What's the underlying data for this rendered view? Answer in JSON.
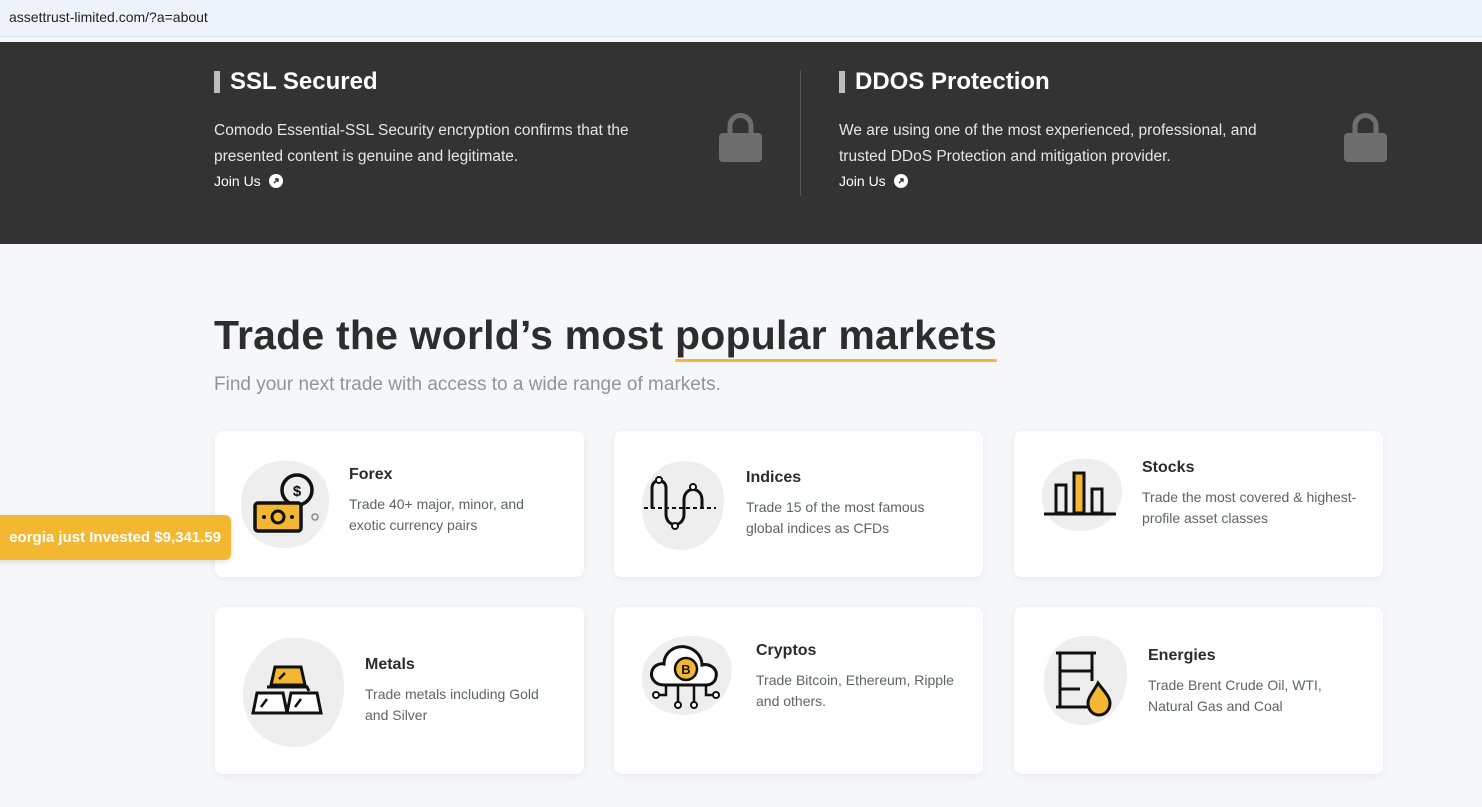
{
  "browser": {
    "url": "assettrust-limited.com/?a=about"
  },
  "security": {
    "ssl": {
      "title": "SSL Secured",
      "description": "Comodo Essential-SSL Security encryption confirms that the presented content is genuine and legitimate.",
      "link": "Join Us"
    },
    "ddos": {
      "title": "DDOS Protection",
      "description": "We are using one of the most experienced, professional, and trusted DDoS Protection and mitigation provider.",
      "link": "Join Us"
    }
  },
  "markets": {
    "heading_pre": "Trade the world’s most ",
    "heading_highlight": "popular markets",
    "subheading": "Find your next trade with access to a wide range of markets.",
    "items": [
      {
        "title": "Forex",
        "description": "Trade 40+ major, minor, and exotic currency pairs",
        "icon": "forex-icon"
      },
      {
        "title": "Indices",
        "description": "Trade 15 of the most famous global indices as CFDs",
        "icon": "indices-icon"
      },
      {
        "title": "Stocks",
        "description": "Trade the most covered & highest-profile asset classes",
        "icon": "stocks-icon"
      },
      {
        "title": "Metals",
        "description": "Trade metals including Gold and Silver",
        "icon": "metals-icon"
      },
      {
        "title": "Cryptos",
        "description": "Trade Bitcoin, Ethereum, Ripple and others.",
        "icon": "cryptos-icon"
      },
      {
        "title": "Energies",
        "description": "Trade Brent Crude Oil, WTI, Natural Gas and Coal",
        "icon": "energies-icon"
      }
    ]
  },
  "notification": {
    "text": "eorgia just Invested $9,341.59"
  },
  "colors": {
    "accent": "#f4b731",
    "dark_band": "#333333",
    "background": "#f5f7fa"
  }
}
